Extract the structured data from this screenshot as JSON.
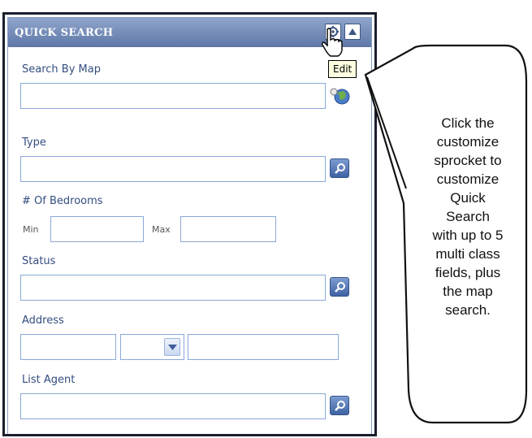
{
  "panel": {
    "title": "QUICK SEARCH",
    "tooltip": "Edit",
    "search_by_map_label": "Search By Map",
    "type_label": "Type",
    "bedrooms_label": "# Of Bedrooms",
    "min_label": "Min",
    "max_label": "Max",
    "status_label": "Status",
    "address_label": "Address",
    "list_agent_label": "List Agent"
  },
  "icons": {
    "sprocket": "gear-icon",
    "collapse": "triangle-up-icon",
    "lookup": "magnifier-icon",
    "map": "globe-icon",
    "dropdown": "chevron-down-icon",
    "cursor": "hand-pointer-icon"
  },
  "callout": {
    "lines": [
      "Click the",
      "customize",
      "sprocket to",
      "customize",
      "Quick",
      "Search",
      "with up to 5",
      "multi class",
      "fields, plus",
      "the map",
      "search."
    ]
  },
  "colors": {
    "titlebar": "#6f87b5",
    "label": "#334d80",
    "field_border": "#8aa7d9",
    "frame": "#1a1f2c"
  }
}
